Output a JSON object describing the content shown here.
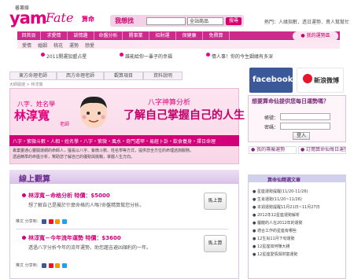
{
  "header": {
    "logo_small": "蕃薯藤",
    "logo_brand": "yam",
    "logo_fate": "Fate",
    "logo_cn": "算命",
    "search_label": "我想找",
    "search_placeholder": "",
    "search_select": "全站商品",
    "search_button": "搜尋",
    "hot_links": "熱門：人緣指數．透日運勢．貴人幫幫忙"
  },
  "nav": {
    "items": [
      "回首頁",
      "求愛情",
      "談情趣",
      "命盤分析",
      "開事業",
      "招財運",
      "保健康",
      "免費算"
    ],
    "member_button": "● 我的運勢區"
  },
  "subnav": {
    "items": [
      "愛情",
      "婚姻",
      "桃花",
      "運勢",
      "戀愛"
    ]
  },
  "news": [
    "2011開運加盟占星",
    "誰能給你一輩子的幸福",
    "情人事！你的今生姻緣有多深"
  ],
  "tabs": [
    "東方命理老師",
    "西方命理老師",
    "觀算項目",
    "資料說明"
  ],
  "breadcrumb": "大師開運 > 林淳寬",
  "banner": {
    "sub": "八字．姓名學",
    "name": "林淳寬",
    "title_small": "老師",
    "analysis": "八字神算分析",
    "slogan": "了解自己掌握自己的人生",
    "strip": "八字・紫微斗數・人相・姓名學・八字・紫微・風水・奇門遁甲・易經卜卦・飲食養身・擇日命理",
    "desc1": "專業靈通心靈開運網的命師人，擅長以八字、紫微斗數、姓名學等方式，提供您全方位的命理諮詢服務。",
    "desc2": "透過精準的命盤分析，幫助您了解自己的優勢與挑戰，掌握人生方向。"
  },
  "products": {
    "title": "線上觀算",
    "items": [
      {
        "title": "林淳寬－命格分析 特價：$5000",
        "desc": "想了解自己是屬於什麼命格的人嗎?命盤精算幫您分析。",
        "button": "馬上算",
        "share": "推文 分享到："
      },
      {
        "title": "林淳寬－今年流年運勢 特價：$3600",
        "desc": "透過八字分析今年的流年運勢，助您趨吉避凶順利的一年。",
        "button": "馬上算",
        "share": "推文 分享到："
      }
    ]
  },
  "social": {
    "facebook": "facebook",
    "weibo": "新浪微博"
  },
  "fortune_box": {
    "title": "想要算命仙提供您每日運勢嗎？",
    "account_label": "帳號：",
    "password_label": "密碼：",
    "login_button": "登入",
    "link1": "● 我的專屬運勢",
    "link2": "● 訂閱算命仙每日運勢"
  },
  "side_list": {
    "title": "算命仙精選文章",
    "items": [
      "● 星座運勢提醒(11/20-11/26)",
      "● 生肖運勢(11/20~11/26)",
      "● 本週運勢提醒11月21日~11月27日",
      "● 2012年12星座運勢解析",
      "● 屬龍的人在2012年的運勢",
      "● 適合工作的星座有哪些",
      "● 12生肖11月下旬運勢",
      "● 12星座如何賺大錢",
      "● 12星座愛情與財富運勢"
    ]
  }
}
